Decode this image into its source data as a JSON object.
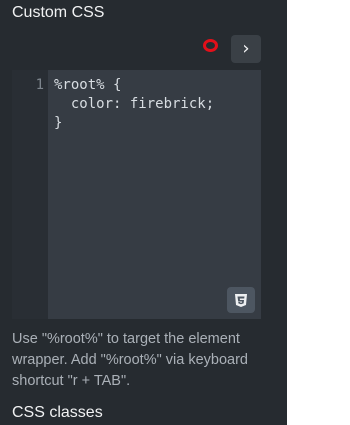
{
  "panel": {
    "title": "Custom CSS",
    "section_title": "CSS classes"
  },
  "toolbar": {
    "run_icon": "chevron-right-icon",
    "run_glyph": "›",
    "record_indicator_color": "#e2101a"
  },
  "editor": {
    "line_numbers": [
      "1"
    ],
    "code": "%root% {\n  color: firebrick;\n}",
    "css_icon": "css3-icon"
  },
  "help": {
    "text": "Use \"%root%\" to target the element wrapper. Add \"%root%\" via keyboard shortcut \"r + TAB\"."
  }
}
